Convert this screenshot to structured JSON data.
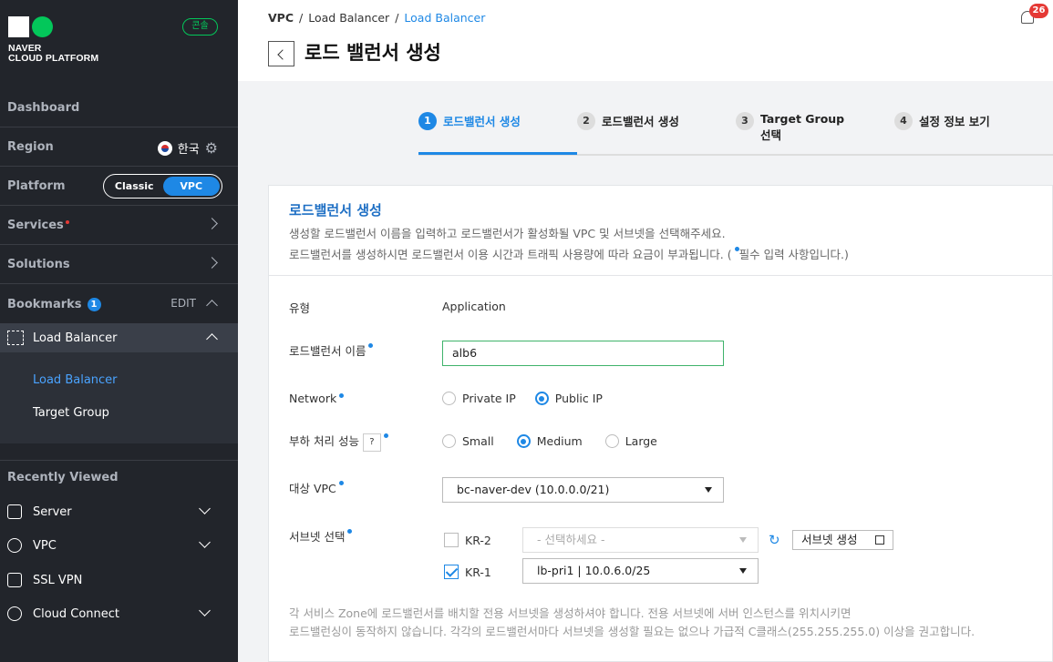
{
  "sidebar": {
    "logo_line1": "NAVER",
    "logo_line2": "CLOUD PLATFORM",
    "console_label": "콘솔",
    "dashboard": "Dashboard",
    "region_label": "Region",
    "region_value": "한국",
    "platform_label": "Platform",
    "platform_classic": "Classic",
    "platform_vpc": "VPC",
    "services": "Services",
    "solutions": "Solutions",
    "bookmarks": "Bookmarks",
    "bookmarks_count": "1",
    "edit": "EDIT",
    "lb_head": "Load Balancer",
    "lb_sub1": "Load Balancer",
    "lb_sub2": "Target Group",
    "recently_viewed": "Recently Viewed",
    "rv_items": [
      "Server",
      "VPC",
      "SSL VPN",
      "Cloud Connect"
    ]
  },
  "header": {
    "crumb_root": "VPC",
    "crumb_mid": "Load Balancer",
    "crumb_active": "Load Balancer",
    "title": "로드 밸런서 생성",
    "notifications": "26"
  },
  "steps": [
    {
      "num": "1",
      "label": "로드밸런서 생성"
    },
    {
      "num": "2",
      "label": "로드밸런서 생성"
    },
    {
      "num": "3",
      "label": "Target Group 선택"
    },
    {
      "num": "4",
      "label": "설정 정보 보기"
    }
  ],
  "form": {
    "title": "로드밸런서 생성",
    "desc1": "생성할 로드밸런서 이름을 입력하고 로드밸런서가 활성화될 VPC 및 서브넷을 선택해주세요.",
    "desc2": "로드밸런서를 생성하시면 로드밸런서 이용 시간과 트래픽 사용량에 따라 요금이 부과됩니다. (",
    "desc2_tail": "필수 입력 사항입니다.)",
    "type_label": "유형",
    "type_value": "Application",
    "name_label": "로드밸런서 이름",
    "name_value": "alb6",
    "network_label": "Network",
    "network_private": "Private IP",
    "network_public": "Public IP",
    "perf_label": "부하 처리 성능",
    "perf_small": "Small",
    "perf_medium": "Medium",
    "perf_large": "Large",
    "vpc_label": "대상 VPC",
    "vpc_value": "bc-naver-dev (10.0.0.0/21)",
    "subnet_label": "서브넷 선택",
    "kr2_label": "KR-2",
    "kr2_placeholder": "- 선택하세요 -",
    "kr1_label": "KR-1",
    "kr1_value": "lb-pri1 | 10.0.6.0/25",
    "create_subnet": "서브넷 생성",
    "note1": "각 서비스 Zone에 로드밸런서를 배치할 전용 서브넷을 생성하셔야 합니다. 전용 서브넷에 서버 인스턴스를 위치시키면",
    "note2": "로드밸런싱이 동작하지 않습니다. 각각의 로드밸런서마다 서브넷을 생성할 필요는 없으나 가급적 C클래스(255.255.255.0) 이상을 권고합니다."
  }
}
